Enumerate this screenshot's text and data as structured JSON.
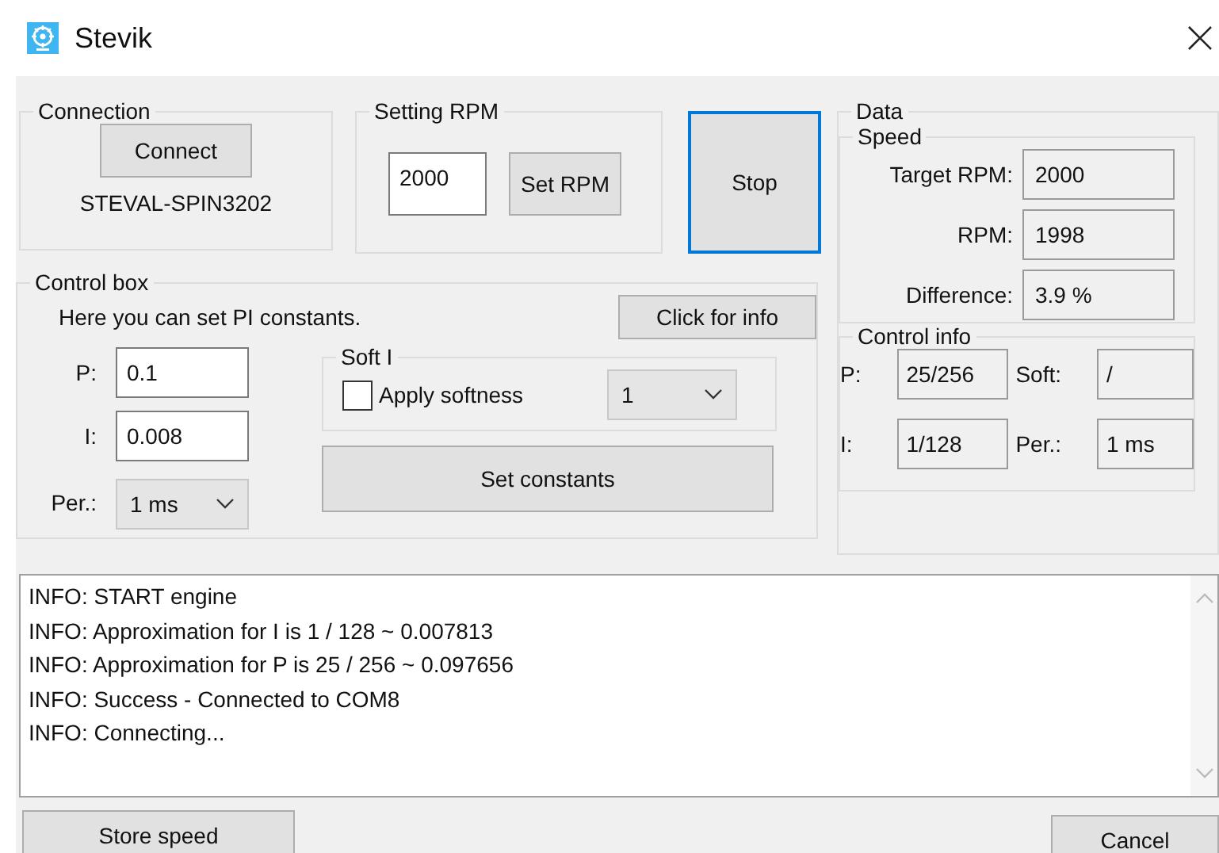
{
  "window": {
    "title": "Stevik"
  },
  "connection": {
    "title": "Connection",
    "button": "Connect",
    "device": "STEVAL-SPIN3202"
  },
  "setting_rpm": {
    "title": "Setting RPM",
    "value": "2000",
    "button": "Set RPM"
  },
  "stop_button": {
    "label": "Stop",
    "focused": true
  },
  "control_box": {
    "title": "Control box",
    "hint": "Here you can set PI constants.",
    "info_button": "Click for info",
    "fields": [
      {
        "label": "P:",
        "value": "0.1",
        "kind": "text"
      },
      {
        "label": "I:",
        "value": "0.008",
        "kind": "text"
      },
      {
        "label": "Per.:",
        "value": "1 ms",
        "kind": "dropdown"
      }
    ],
    "soft_i": {
      "title": "Soft I",
      "checkbox": {
        "label": "Apply softness",
        "checked": false
      },
      "dropdown": "1"
    },
    "set_button": "Set constants"
  },
  "data": {
    "title": "Data",
    "speed": {
      "title": "Speed",
      "rows": [
        {
          "label": "Target RPM:",
          "value": "2000"
        },
        {
          "label": "RPM:",
          "value": "1998"
        },
        {
          "label": "Difference:",
          "value": "3.9 %"
        }
      ]
    },
    "control_info": {
      "title": "Control info",
      "items": [
        {
          "label": "P:",
          "value": "25/256"
        },
        {
          "label": "Soft:",
          "value": "/"
        },
        {
          "label": "I:",
          "value": "1/128"
        },
        {
          "label": "Per.:",
          "value": "1 ms"
        }
      ]
    }
  },
  "log": {
    "lines": [
      "INFO: START engine",
      "INFO: Approximation for I is 1 / 128 ~ 0.007813",
      "INFO: Approximation for P is 25 / 256 ~ 0.097656",
      "INFO: Success - Connected to COM8",
      "INFO: Connecting..."
    ]
  },
  "buttons": [
    {
      "label": "Store speed",
      "kind": "left"
    },
    {
      "label": "Cancel",
      "kind": "right"
    }
  ]
}
